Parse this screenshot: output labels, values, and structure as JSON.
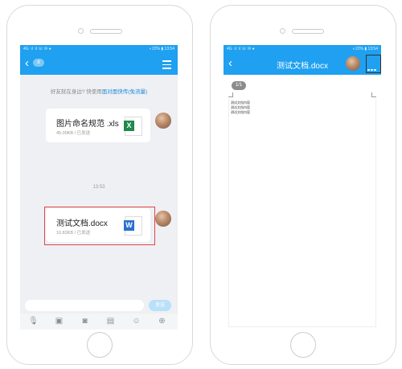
{
  "left_phone": {
    "status": {
      "left": "4G ᐧıl ᐧıl ☏ ✉ ●",
      "right": "◐22% ▮ 13:54"
    },
    "badge": "8",
    "hint": {
      "text": "好友就在身边? 快使用",
      "link": "面对面快传(免流量)"
    },
    "files": [
      {
        "name": "图片命名规范 .xls",
        "meta": "45.00KB / 已发送",
        "icon_letter": "X",
        "icon_color": "#1e8a4a"
      },
      {
        "name": "测试文档.docx",
        "meta": "10.82KB / 已发送",
        "icon_letter": "W",
        "icon_color": "#2a6fd0"
      }
    ],
    "timestamp": "13:53",
    "send_label": "发送",
    "toolbar_icons": [
      "mic-icon",
      "image-icon",
      "camera-icon",
      "folder-icon",
      "emoji-icon",
      "plus-icon"
    ],
    "colors": {
      "accent": "#1fa0f0",
      "highlight": "#e14545"
    }
  },
  "right_phone": {
    "status": {
      "left": "4G ᐧıl ᐧıl ☏ ✉ ●",
      "right": "◐22% ▮ 13:54"
    },
    "title": "测试文档.docx",
    "page_indicator": "1/1",
    "doc_lines": [
      "测试文档内容",
      "测试文档内容",
      "测试文档内容"
    ]
  }
}
